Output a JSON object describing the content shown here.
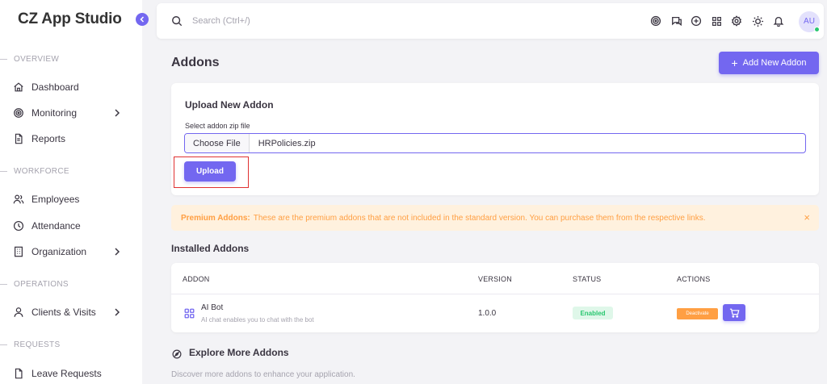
{
  "app": {
    "title": "CZ App Studio"
  },
  "sidebar": {
    "sections": [
      {
        "label": "OVERVIEW"
      },
      {
        "label": "WORKFORCE"
      },
      {
        "label": "OPERATIONS"
      },
      {
        "label": "REQUESTS"
      }
    ],
    "items": [
      {
        "label": "Dashboard",
        "icon": "home-icon"
      },
      {
        "label": "Monitoring",
        "icon": "target-icon",
        "has_submenu": true
      },
      {
        "label": "Reports",
        "icon": "file-text-icon"
      },
      {
        "label": "Employees",
        "icon": "users-icon"
      },
      {
        "label": "Attendance",
        "icon": "clock-icon"
      },
      {
        "label": "Organization",
        "icon": "building-icon",
        "has_submenu": true
      },
      {
        "label": "Clients & Visits",
        "icon": "user-icon",
        "has_submenu": true
      },
      {
        "label": "Leave Requests",
        "icon": "file-icon"
      }
    ]
  },
  "topbar": {
    "search_placeholder": "Search (Ctrl+/)",
    "icons": [
      "target-icon",
      "chat-icon",
      "add-circle-icon",
      "apps-grid-icon",
      "settings-icon",
      "sun-icon",
      "bell-icon"
    ],
    "avatar_initials": "AU",
    "avatar_status_color": "#28c76f"
  },
  "page": {
    "title": "Addons",
    "add_button_label": "Add New Addon"
  },
  "upload": {
    "title": "Upload New Addon",
    "field_label": "Select addon zip file",
    "choose_label": "Choose File",
    "file_name": "HRPolicies.zip",
    "button_label": "Upload"
  },
  "alert": {
    "strong": "Premium Addons:",
    "text": "These are the premium addons that are not included in the standard version. You can purchase them from the respective links.",
    "close": "×"
  },
  "installed": {
    "title": "Installed Addons",
    "columns": [
      "ADDON",
      "VERSION",
      "STATUS",
      "ACTIONS"
    ],
    "rows": [
      {
        "name": "AI Bot",
        "description": "AI chat enables you to chat with the bot",
        "version": "1.0.0",
        "status": "Enabled",
        "action_label": "Deactivate",
        "icon": "grid-icon"
      }
    ]
  },
  "explore": {
    "title": "Explore More Addons",
    "description": "Discover more addons to enhance your application."
  },
  "colors": {
    "primary": "#7367f0",
    "warning": "#ff9f43",
    "success": "#28c76f",
    "highlight": "#e03131"
  }
}
